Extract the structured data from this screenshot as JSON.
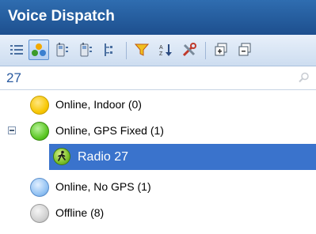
{
  "window": {
    "title": "Voice Dispatch"
  },
  "toolbar": {
    "buttons": [
      {
        "icon": "list-view-icon"
      },
      {
        "icon": "group-status-icon",
        "active": true
      },
      {
        "icon": "radio-list-icon"
      },
      {
        "icon": "radio-details-icon"
      },
      {
        "icon": "tree-view-icon"
      },
      {
        "icon": "filter-icon"
      },
      {
        "icon": "sort-icon"
      },
      {
        "icon": "tools-icon"
      },
      {
        "icon": "expand-all-icon"
      },
      {
        "icon": "collapse-all-icon"
      }
    ]
  },
  "search": {
    "value": "27"
  },
  "tree": {
    "groups": [
      {
        "label": "Online, Indoor (0)",
        "color": "#f7c600"
      },
      {
        "label": "Online, GPS Fixed (1)",
        "color": "#58c520",
        "expanded": true
      },
      {
        "label": "Online, No GPS (1)",
        "color": "#8fc0f2"
      },
      {
        "label": "Offline (8)",
        "color": "#cfcfcf"
      }
    ],
    "child": {
      "label": "Radio 27",
      "selected": true
    }
  },
  "colors": {
    "title_bar": "#2a63a6",
    "selection": "#3a73cc",
    "search_text": "#2a5aa0"
  }
}
